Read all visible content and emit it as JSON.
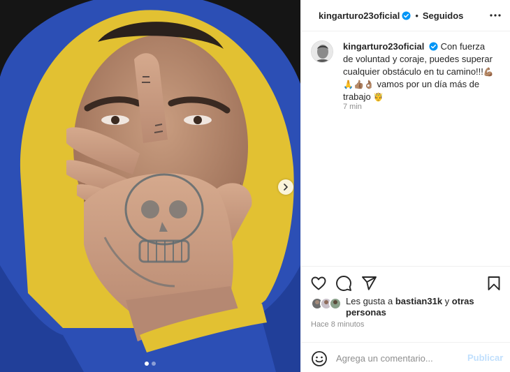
{
  "header": {
    "username": "kingarturo23oficial",
    "separator": "•",
    "follow_status": "Seguidos",
    "more_icon": "more-horizontal-icon",
    "verified_icon": "verified-badge-icon"
  },
  "caption": {
    "username": "kingarturo23oficial",
    "text_part1": "Con fuerza de voluntad y coraje, puedes superar cualquier obstáculo en tu camino!!!",
    "emojis": "💪🏽🙏👍🏽👌🏽",
    "text_part2": "vamos por un día más de trabajo",
    "emoji_end": "🤴",
    "time": "7 min"
  },
  "actions": {
    "like_icon": "heart-icon",
    "comment_icon": "comment-icon",
    "share_icon": "share-icon",
    "save_icon": "bookmark-icon"
  },
  "likes": {
    "prefix": "Les gusta a",
    "user": "bastian31k",
    "connector": "y",
    "others": "otras personas"
  },
  "post_time": "Hace 8 minutos",
  "comment": {
    "placeholder": "Agrega un comentario...",
    "publish_label": "Publicar",
    "emoji_icon": "smile-icon"
  },
  "carousel": {
    "total": 2,
    "current": 1,
    "next_icon": "chevron-right-icon"
  },
  "colors": {
    "accent": "#0095f6",
    "publish_disabled": "#c0dffd",
    "hood_blue": "#2b4fb8",
    "hood_yellow": "#e3c233"
  }
}
